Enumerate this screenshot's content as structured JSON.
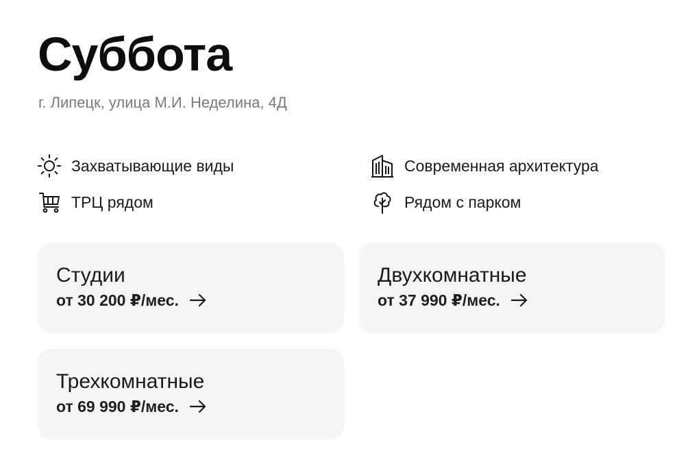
{
  "header": {
    "title": "Суббота",
    "address": "г. Липецк, улица М.И. Неделина, 4Д"
  },
  "features": [
    {
      "label": "Захватывающие виды",
      "icon": "sun-icon"
    },
    {
      "label": "ТРЦ рядом",
      "icon": "shopping-cart-icon"
    },
    {
      "label": "Современная архитектура",
      "icon": "building-icon"
    },
    {
      "label": "Рядом с парком",
      "icon": "tree-icon"
    }
  ],
  "cards": [
    {
      "title": "Студии",
      "price": "от 30 200 ₽/мес.",
      "icon": "arrow-right-icon"
    },
    {
      "title": "Двухкомнатные",
      "price": "от 37 990 ₽/мес.",
      "icon": "arrow-right-icon"
    },
    {
      "title": "Трехкомнатные",
      "price": "от 69 990 ₽/мес.",
      "icon": "arrow-right-icon"
    }
  ],
  "colors": {
    "title": "#0d0d0d",
    "address": "#7a7a7a",
    "card_background": "#f5f5f5",
    "text": "#1a1a1a"
  }
}
